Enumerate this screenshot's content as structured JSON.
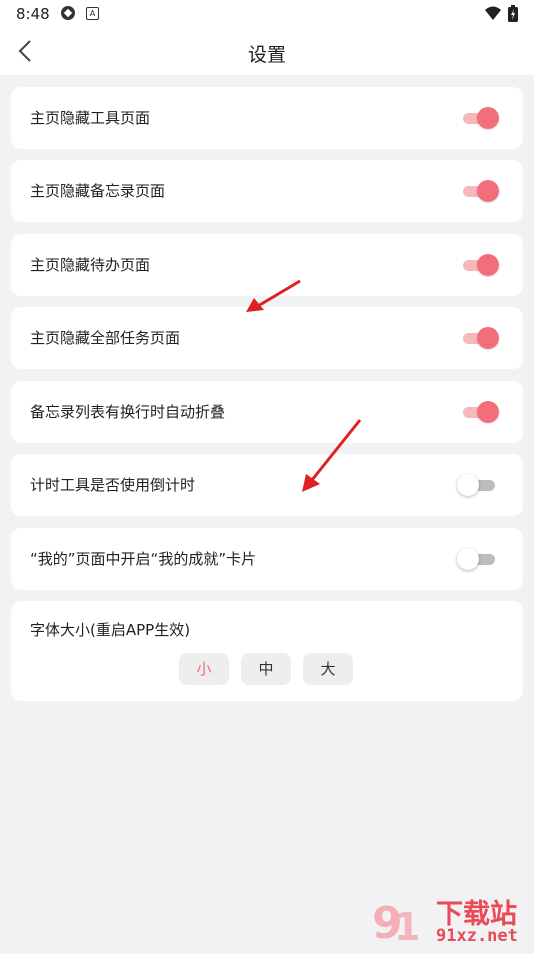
{
  "status_bar": {
    "time": "8:48",
    "notif_icon_letter": "A"
  },
  "header": {
    "title": "设置"
  },
  "settings": [
    {
      "label": "主页隐藏工具页面",
      "on": true
    },
    {
      "label": "主页隐藏备忘录页面",
      "on": true
    },
    {
      "label": "主页隐藏待办页面",
      "on": true
    },
    {
      "label": "主页隐藏全部任务页面",
      "on": true
    },
    {
      "label": "备忘录列表有换行时自动折叠",
      "on": true
    },
    {
      "label": "计时工具是否使用倒计时",
      "on": false
    },
    {
      "label": "“我的”页面中开启“我的成就”卡片",
      "on": false
    }
  ],
  "font_size": {
    "label": "字体大小(重启APP生效)",
    "options": [
      "小",
      "中",
      "大"
    ],
    "selected": "小"
  },
  "watermark": {
    "text": "下载站",
    "domain": "91xz.net"
  },
  "colors": {
    "accent": "#f26e7a",
    "arrow": "#e02020"
  }
}
